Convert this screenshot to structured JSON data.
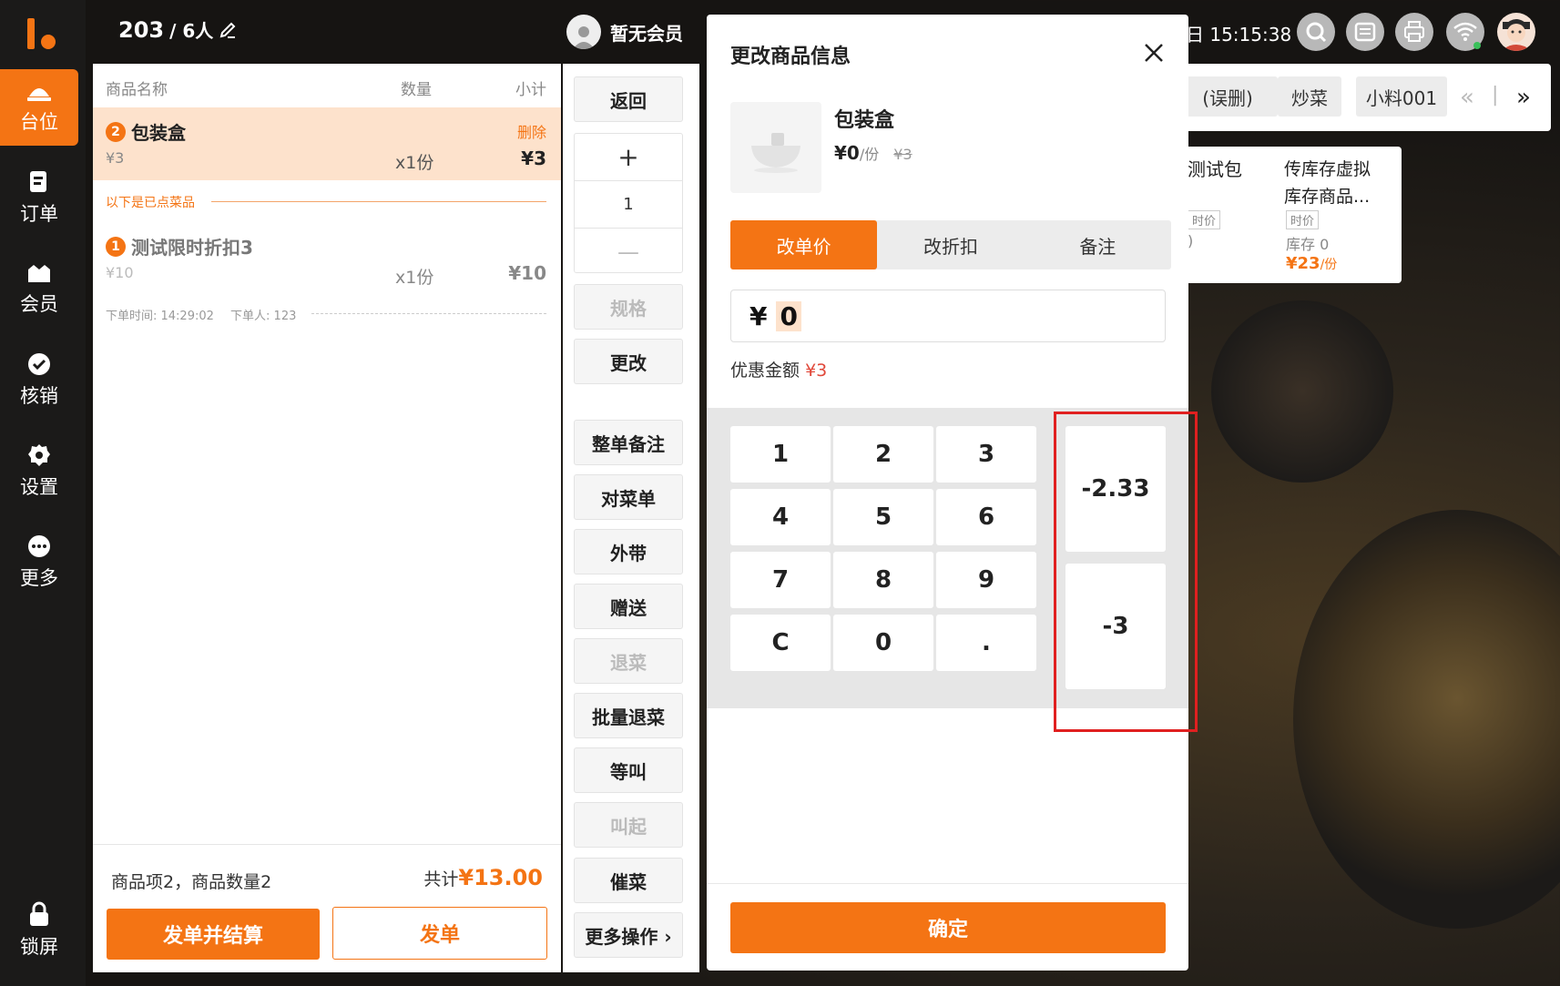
{
  "sidebar": {
    "items": [
      {
        "label": "台位",
        "icon": "table-icon",
        "active": true
      },
      {
        "label": "订单",
        "icon": "order-icon"
      },
      {
        "label": "会员",
        "icon": "member-icon"
      },
      {
        "label": "核销",
        "icon": "verify-icon"
      },
      {
        "label": "设置",
        "icon": "gear-icon"
      },
      {
        "label": "更多",
        "icon": "more-icon"
      }
    ],
    "lock": {
      "label": "锁屏",
      "icon": "lock-icon"
    }
  },
  "topbar": {
    "table_no": "203",
    "people": "/ 6人",
    "member": "暂无会员",
    "clock": "日 15:15:38",
    "icons": [
      "search-icon",
      "list-icon",
      "printer-icon",
      "wifi-icon",
      "user-avatar"
    ]
  },
  "order": {
    "headers": {
      "name": "商品名称",
      "qty": "数量",
      "subtotal": "小计"
    },
    "current_item": {
      "index": "2",
      "name": "包装盒",
      "unit_price": "¥3",
      "qty": "x1份",
      "subtotal": "¥3",
      "delete_label": "删除"
    },
    "divider_label": "以下是已点菜品",
    "ordered_item": {
      "index": "1",
      "name": "测试限时折扣3",
      "unit_price": "¥10",
      "qty": "x1份",
      "subtotal": "¥10"
    },
    "meta": {
      "time": "下单时间: 14:29:02",
      "person": "下单人: 123"
    },
    "summary": {
      "left": "商品项2，商品数量2",
      "total_label": "共计",
      "total": "¥13.00"
    },
    "buttons": {
      "checkout": "发单并结算",
      "send": "发单"
    }
  },
  "actions": {
    "back": "返回",
    "stepper": {
      "plus": "+",
      "value": "1",
      "minus": "—"
    },
    "spec": "规格",
    "change": "更改",
    "order_note": "整单备注",
    "check_menu": "对菜单",
    "takeout": "外带",
    "gift": "赠送",
    "refund": "退菜",
    "batch_refund": "批量退菜",
    "hold": "等叫",
    "call": "叫起",
    "urge": "催菜",
    "more": "更多操作 ›"
  },
  "categories": {
    "tabs": [
      "(误删)",
      "炒菜",
      "小料001"
    ],
    "prev": "«",
    "sep": "|",
    "next": "»"
  },
  "products": [
    {
      "name": "测试包",
      "tag": "时价",
      "stock": ")"
    },
    {
      "name": "传库存虚拟\n库存商品...",
      "tag": "时价",
      "stock": "库存 0",
      "price": "¥23",
      "unit": "/份"
    }
  ],
  "modal": {
    "title": "更改商品信息",
    "product": {
      "name": "包装盒",
      "price": "¥0",
      "unit": "/份",
      "original": "¥3"
    },
    "tabs": [
      {
        "label": "改单价",
        "active": true
      },
      {
        "label": "改折扣"
      },
      {
        "label": "备注"
      }
    ],
    "input": {
      "currency": "¥",
      "value": "0"
    },
    "discount": {
      "label": "优惠金额",
      "value": "¥3"
    },
    "keys": [
      "1",
      "2",
      "3",
      "4",
      "5",
      "6",
      "7",
      "8",
      "9",
      "C",
      "0",
      "."
    ],
    "quick_keys": [
      "-2.33",
      "-3"
    ],
    "confirm": "确定"
  },
  "colors": {
    "accent": "#f47414",
    "highlight": "#e02020",
    "discount_red": "#e0483a"
  }
}
